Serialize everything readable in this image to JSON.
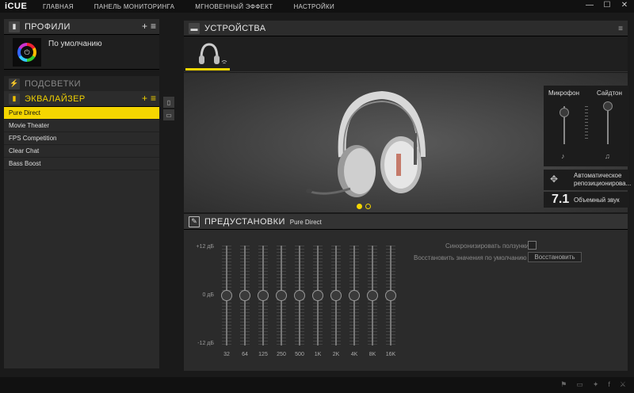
{
  "app": {
    "logo": "iCUE"
  },
  "nav": [
    "ГЛАВНАЯ",
    "ПАНЕЛЬ МОНИТОРИНГА",
    "МГНОВЕННЫЙ ЭФФЕКТ",
    "НАСТРОЙКИ"
  ],
  "window": {
    "minimize": "—",
    "maximize": "☐",
    "close": "✕"
  },
  "profiles": {
    "title": "ПРОФИЛИ",
    "add": "+",
    "menu": "≡",
    "current": "По умолчанию"
  },
  "backlight": {
    "title": "ПОДСВЕТКИ"
  },
  "equalizer": {
    "title": "ЭКВАЛАЙЗЕР",
    "add": "+",
    "menu": "≡",
    "items": [
      "Pure Direct",
      "Movie Theater",
      "FPS Competition",
      "Clear Chat",
      "Bass Boost"
    ],
    "active_index": 0
  },
  "devices": {
    "title": "УСТРОЙСТВА"
  },
  "mic": {
    "mic_label": "Микрофон",
    "sidetone_label": "Сайдтон",
    "mic_level": 0.92,
    "sidetone_level": 1.0
  },
  "auto_reposition": {
    "label": "Автоматическое репозиционирова..."
  },
  "surround": {
    "number": "7.1",
    "label": "Объемный звук"
  },
  "presets": {
    "title": "ПРЕДУСТАНОВКИ",
    "current": "Pure Direct",
    "db_top": "+12 дБ",
    "db_mid": "0 дБ",
    "db_bottom": "-12 дБ",
    "sync_label": "Синхронизировать ползунки",
    "restore_label": "Восстановить значения по умолчанию",
    "restore_button": "Восстановить",
    "bands": [
      {
        "freq": "32",
        "gain": 0
      },
      {
        "freq": "64",
        "gain": 0
      },
      {
        "freq": "125",
        "gain": 0
      },
      {
        "freq": "250",
        "gain": 0
      },
      {
        "freq": "500",
        "gain": 0
      },
      {
        "freq": "1K",
        "gain": 0
      },
      {
        "freq": "2K",
        "gain": 0
      },
      {
        "freq": "4K",
        "gain": 0
      },
      {
        "freq": "8K",
        "gain": 0
      },
      {
        "freq": "16K",
        "gain": 0
      }
    ]
  },
  "colors": {
    "accent": "#f5d600",
    "bg": "#1a1a1a"
  },
  "footer_icons": [
    "forum-icon",
    "chat-icon",
    "twitter-icon",
    "facebook-icon",
    "corsair-icon"
  ]
}
